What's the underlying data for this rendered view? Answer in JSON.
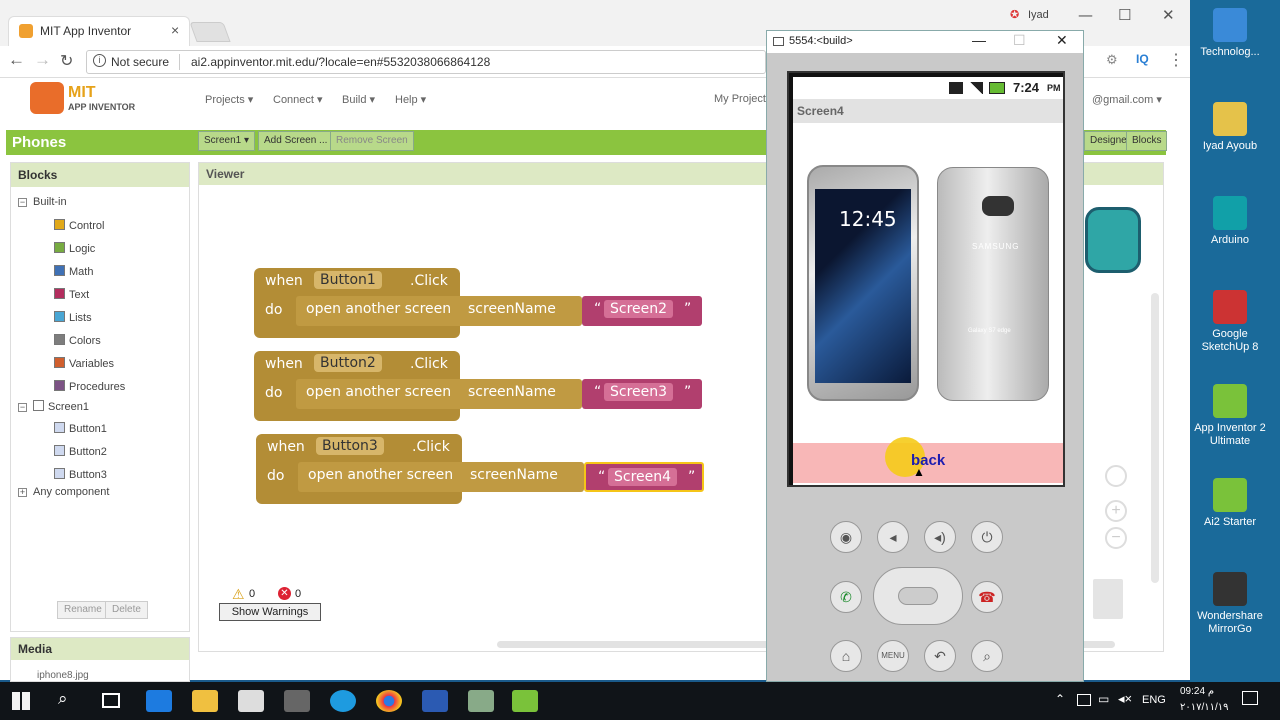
{
  "browser": {
    "tab_title": "MIT App Inventor",
    "tab_close": "×",
    "not_secure": "Not secure",
    "url": "ai2.appinventor.mit.edu/?locale=en#5532038066864128",
    "user_label": "Iyad",
    "minimize": "—",
    "maximize": "☐",
    "close": "✕"
  },
  "app": {
    "logo_mit": "MIT",
    "logo_sub": "APP INVENTOR",
    "menus": [
      "Projects ▾",
      "Connect ▾",
      "Build ▾",
      "Help ▾"
    ],
    "my_projects": "My Projects",
    "account": "@gmail.com ▾",
    "project_name": "Phones",
    "screen_select": "Screen1 ▾",
    "add_screen": "Add Screen ...",
    "remove_screen": "Remove Screen",
    "designer": "Designer",
    "blocks_btn": "Blocks"
  },
  "blocks_panel": {
    "header": "Blocks",
    "builtin": "Built-in",
    "items": [
      {
        "label": "Control",
        "color": "#e1a91a"
      },
      {
        "label": "Logic",
        "color": "#77ab41"
      },
      {
        "label": "Math",
        "color": "#3f71b5"
      },
      {
        "label": "Text",
        "color": "#b32d5e"
      },
      {
        "label": "Lists",
        "color": "#49a6d4"
      },
      {
        "label": "Colors",
        "color": "#7d7d7d"
      },
      {
        "label": "Variables",
        "color": "#d05f2d"
      },
      {
        "label": "Procedures",
        "color": "#7c5385"
      }
    ],
    "screen": "Screen1",
    "components": [
      "Button1",
      "Button2",
      "Button3"
    ],
    "any_component": "Any component",
    "rename": "Rename",
    "delete": "Delete"
  },
  "media": {
    "header": "Media",
    "file": "iphone8.jpg"
  },
  "viewer": {
    "header": "Viewer",
    "blocks": [
      {
        "when": "when",
        "component": "Button1",
        "event": ".Click",
        "do": "do",
        "call": "open another screen",
        "param": "screenName",
        "value": "Screen2"
      },
      {
        "when": "when",
        "component": "Button2",
        "event": ".Click",
        "do": "do",
        "call": "open another screen",
        "param": "screenName",
        "value": "Screen3"
      },
      {
        "when": "when",
        "component": "Button3",
        "event": ".Click",
        "do": "do",
        "call": "open another screen",
        "param": "screenName",
        "value": "Screen4"
      }
    ],
    "warnings_count": "0",
    "errors_count": "0",
    "show_warnings": "Show Warnings"
  },
  "emulator": {
    "title": "5554:<build>",
    "time": "7:24",
    "ampm": "PM",
    "screen_title": "Screen4",
    "phone_clock": "12:45",
    "phone_brand": "SAMSUNG",
    "phone_model": "Galaxy S7 edge",
    "back_button": "back",
    "menu_key": "MENU"
  },
  "desktop": {
    "icons": [
      "Technolog...",
      "Iyad Ayoub",
      "Arduino",
      "Google SketchUp 8",
      "App Inventor 2 Ultimate",
      "Ai2 Starter",
      "Wondershare MirrorGo"
    ]
  },
  "taskbar": {
    "lang": "ENG",
    "time": "09:24 م",
    "date": "٢٠١٧/١١/١٩"
  }
}
